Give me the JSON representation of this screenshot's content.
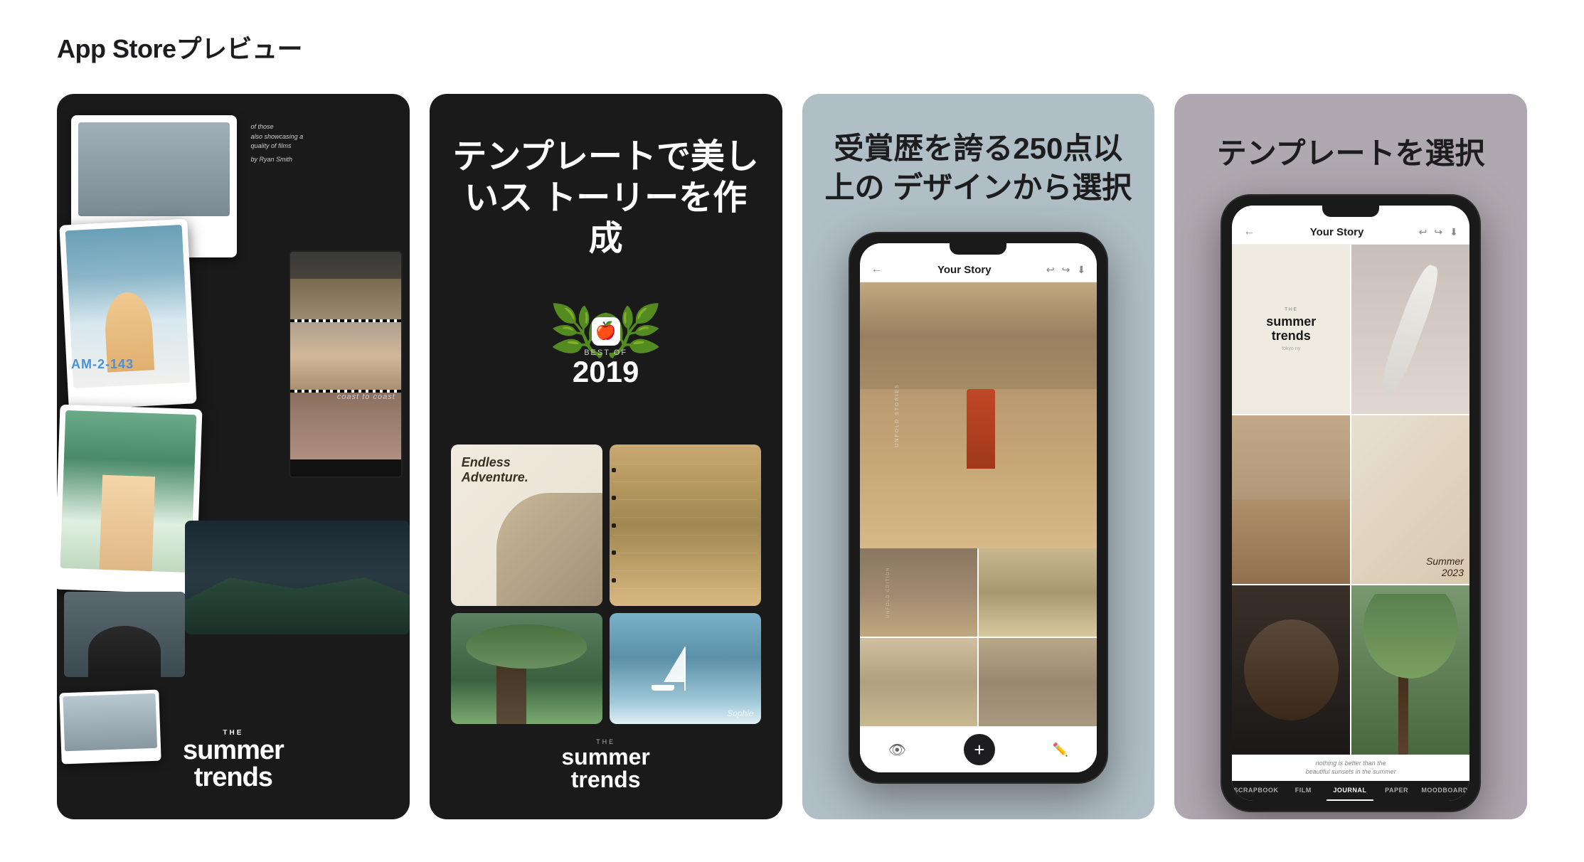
{
  "page": {
    "title": "App Storeプレビュー"
  },
  "cards": [
    {
      "id": "card1",
      "bg_color": "#1a1a1a",
      "description": "Photo collage of travel images",
      "bottom_text_main": "summer\ntrends",
      "bottom_text_prefix": "THE",
      "label": "coast to coast",
      "location_tag": "AM-2-143"
    },
    {
      "id": "card2",
      "bg_color": "#1a1a1a",
      "description": "Award screen",
      "title": "テンプレートで美しいス\nトーリーを作成",
      "award_label_top": "BEST OF",
      "award_year": "2019",
      "ea_text": "Endless\nAdventure.",
      "sail_caption": "Sophie"
    },
    {
      "id": "card3",
      "bg_color": "#b0bec5",
      "description": "Phone mockup - Your Story app",
      "title": "受賞歴を誇る250点以上の\nデザインから選択",
      "phone_header": "Your Story",
      "phone_label": "UNFOLD STORIES"
    },
    {
      "id": "card4",
      "bg_color": "#b0a8b0",
      "description": "Phone mockup - template selection",
      "title": "テンプレートを選択",
      "phone_header": "Your Story",
      "tabs": [
        "SCRAPBOOK",
        "FILM",
        "JOURNAL",
        "PAPER",
        "MOODBOARD"
      ],
      "summer_prefix": "THE",
      "summer_main": "summer\ntrends",
      "summer_sub": "tokyo ny",
      "nothing_text": "nothing is better than the beautiful sunsets in the summer"
    }
  ],
  "icons": {
    "back": "←",
    "undo": "↩",
    "redo": "↪",
    "download": "⬇",
    "eye": "👁",
    "add": "+",
    "pencil": "✏"
  }
}
